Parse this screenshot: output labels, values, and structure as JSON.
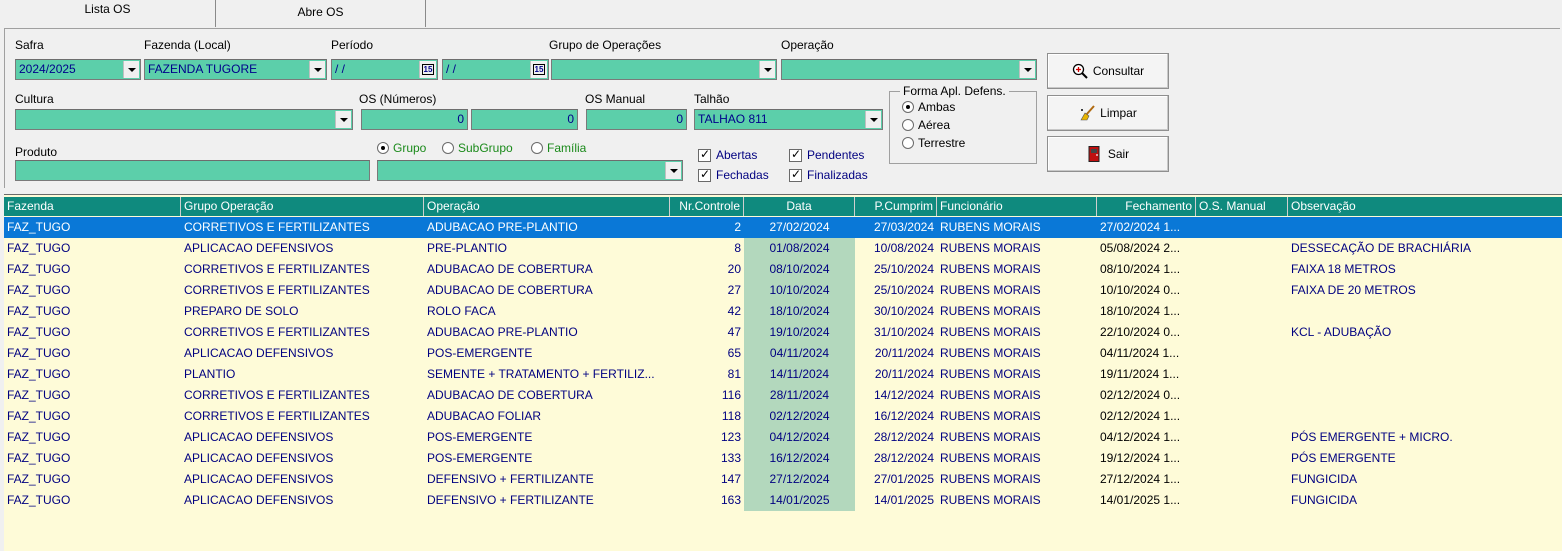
{
  "tabs": [
    {
      "label": "Lista OS"
    },
    {
      "label": "Abre OS"
    }
  ],
  "filters": {
    "safra": {
      "label": "Safra",
      "value": "2024/2025"
    },
    "fazenda": {
      "label": "Fazenda (Local)",
      "value": "FAZENDA TUGORE"
    },
    "periodo": {
      "label": "Período",
      "start": "/ /",
      "end": "/ /"
    },
    "grupo_operacoes": {
      "label": "Grupo de Operações",
      "value": ""
    },
    "operacao": {
      "label": "Operação",
      "value": ""
    },
    "cultura": {
      "label": "Cultura",
      "value": ""
    },
    "os_numeros": {
      "label": "OS (Números)",
      "from": "0",
      "to": "0"
    },
    "os_manual": {
      "label": "OS Manual",
      "value": "0"
    },
    "talhao": {
      "label": "Talhão",
      "value": "TALHAO 811"
    },
    "produto": {
      "label": "Produto",
      "value": ""
    },
    "produto_tipo": {
      "options": [
        {
          "label": "Grupo",
          "selected": true
        },
        {
          "label": "SubGrupo",
          "selected": false
        },
        {
          "label": "Família",
          "selected": false
        }
      ],
      "value": ""
    },
    "status_checks": [
      {
        "label": "Abertas",
        "checked": true
      },
      {
        "label": "Pendentes",
        "checked": true
      },
      {
        "label": "Fechadas",
        "checked": true
      },
      {
        "label": "Finalizadas",
        "checked": true
      }
    ],
    "forma_aplicacao": {
      "title": "Forma Apl. Defens.",
      "options": [
        {
          "label": "Ambas",
          "selected": true
        },
        {
          "label": "Aérea",
          "selected": false
        },
        {
          "label": "Terrestre",
          "selected": false
        }
      ]
    }
  },
  "buttons": {
    "consultar": {
      "label": "Consultar",
      "icon": "magnifier-icon"
    },
    "limpar": {
      "label": "Limpar",
      "icon": "broom-icon"
    },
    "sair": {
      "label": "Sair",
      "icon": "exit-door-icon"
    }
  },
  "colors": {
    "field_bg": "#5ccfaa",
    "grid_header": "#0f8a7e",
    "grid_bg": "#fefbd8",
    "selected_row": "#0a78d7",
    "date_col": "#b3d8bd"
  },
  "grid": {
    "columns": [
      "Fazenda",
      "Grupo Operação",
      "Operação",
      "Nr.Controle",
      "Data",
      "P.Cumprim",
      "Funcionário",
      "Fechamento",
      "O.S. Manual",
      "Observação"
    ],
    "rows": [
      [
        "FAZ_TUGO",
        "CORRETIVOS E FERTILIZANTES",
        "ADUBACAO PRE-PLANTIO",
        "2",
        "27/02/2024",
        "27/03/2024",
        "RUBENS MORAIS",
        "27/02/2024 1...",
        "",
        ""
      ],
      [
        "FAZ_TUGO",
        "APLICACAO DEFENSIVOS",
        "PRE-PLANTIO",
        "8",
        "01/08/2024",
        "10/08/2024",
        "RUBENS MORAIS",
        "05/08/2024 2...",
        "",
        "DESSECAÇÃO DE BRACHIÁRIA"
      ],
      [
        "FAZ_TUGO",
        "CORRETIVOS E FERTILIZANTES",
        "ADUBACAO DE COBERTURA",
        "20",
        "08/10/2024",
        "25/10/2024",
        "RUBENS MORAIS",
        "08/10/2024 1...",
        "",
        "FAIXA 18 METROS"
      ],
      [
        "FAZ_TUGO",
        "CORRETIVOS E FERTILIZANTES",
        "ADUBACAO DE COBERTURA",
        "27",
        "10/10/2024",
        "25/10/2024",
        "RUBENS MORAIS",
        "10/10/2024 0...",
        "",
        "FAIXA DE 20 METROS"
      ],
      [
        "FAZ_TUGO",
        "PREPARO DE SOLO",
        "ROLO FACA",
        "42",
        "18/10/2024",
        "30/10/2024",
        "RUBENS MORAIS",
        "18/10/2024 1...",
        "",
        ""
      ],
      [
        "FAZ_TUGO",
        "CORRETIVOS E FERTILIZANTES",
        "ADUBACAO PRE-PLANTIO",
        "47",
        "19/10/2024",
        "31/10/2024",
        "RUBENS MORAIS",
        "22/10/2024 0...",
        "",
        "KCL - ADUBAÇÃO"
      ],
      [
        "FAZ_TUGO",
        "APLICACAO DEFENSIVOS",
        "POS-EMERGENTE",
        "65",
        "04/11/2024",
        "20/11/2024",
        "RUBENS MORAIS",
        "04/11/2024 1...",
        "",
        ""
      ],
      [
        "FAZ_TUGO",
        "PLANTIO",
        "SEMENTE + TRATAMENTO + FERTILIZ...",
        "81",
        "14/11/2024",
        "20/11/2024",
        "RUBENS MORAIS",
        "19/11/2024 1...",
        "",
        ""
      ],
      [
        "FAZ_TUGO",
        "CORRETIVOS E FERTILIZANTES",
        "ADUBACAO DE COBERTURA",
        "116",
        "28/11/2024",
        "14/12/2024",
        "RUBENS MORAIS",
        "02/12/2024 0...",
        "",
        ""
      ],
      [
        "FAZ_TUGO",
        "CORRETIVOS E FERTILIZANTES",
        "ADUBACAO FOLIAR",
        "118",
        "02/12/2024",
        "16/12/2024",
        "RUBENS MORAIS",
        "02/12/2024 1...",
        "",
        ""
      ],
      [
        "FAZ_TUGO",
        "APLICACAO DEFENSIVOS",
        "POS-EMERGENTE",
        "123",
        "04/12/2024",
        "28/12/2024",
        "RUBENS MORAIS",
        "04/12/2024 1...",
        "",
        "PÓS EMERGENTE + MICRO."
      ],
      [
        "FAZ_TUGO",
        "APLICACAO DEFENSIVOS",
        "POS-EMERGENTE",
        "133",
        "16/12/2024",
        "28/12/2024",
        "RUBENS MORAIS",
        "19/12/2024 1...",
        "",
        "PÓS EMERGENTE"
      ],
      [
        "FAZ_TUGO",
        "APLICACAO DEFENSIVOS",
        "DEFENSIVO + FERTILIZANTE",
        "147",
        "27/12/2024",
        "27/01/2025",
        "RUBENS MORAIS",
        "27/12/2024 1...",
        "",
        "FUNGICIDA"
      ],
      [
        "FAZ_TUGO",
        "APLICACAO DEFENSIVOS",
        "DEFENSIVO + FERTILIZANTE",
        "163",
        "14/01/2025",
        "14/01/2025",
        "RUBENS MORAIS",
        "14/01/2025 1...",
        "",
        "FUNGICIDA"
      ]
    ],
    "selected_row": 0
  }
}
